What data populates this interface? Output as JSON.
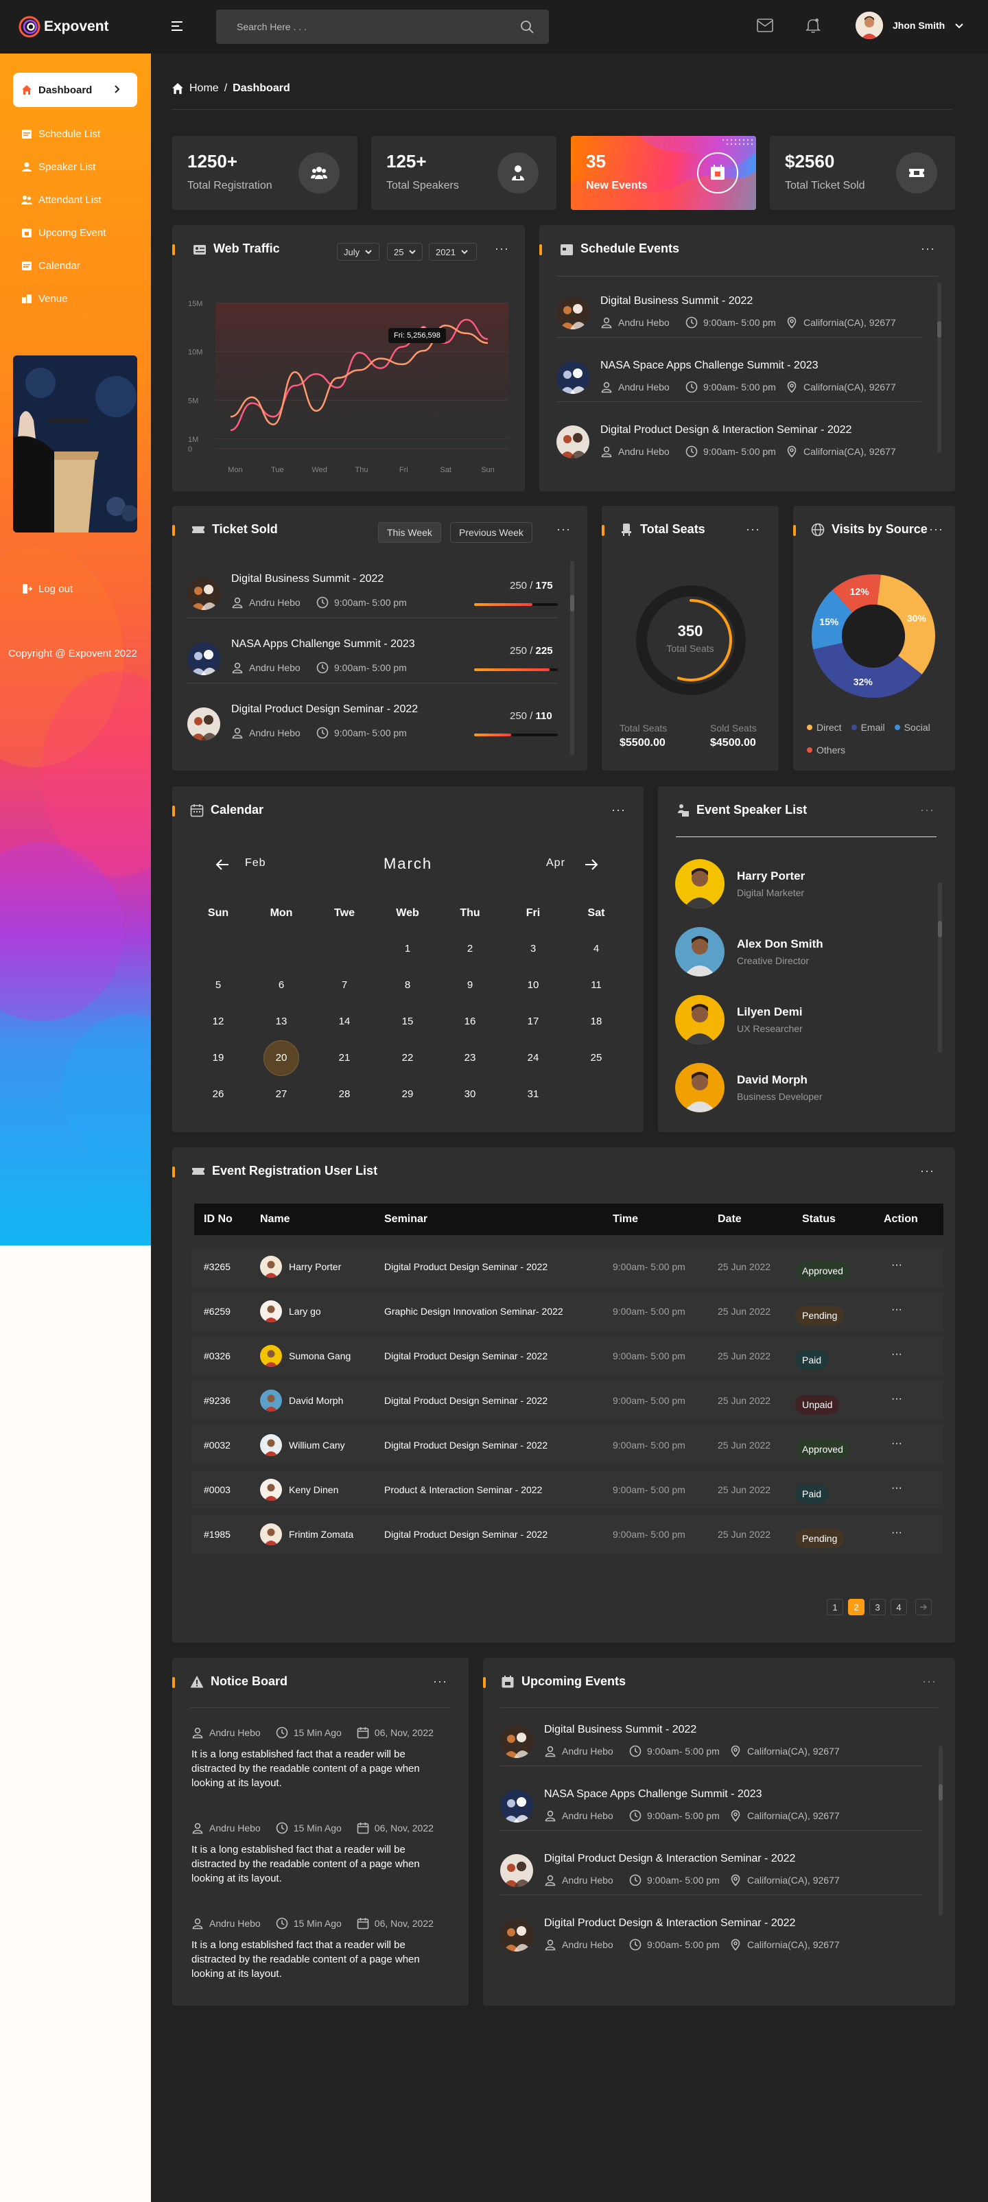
{
  "app": {
    "name": "Expovent"
  },
  "sidebar": {
    "items": [
      {
        "label": "Dashboard"
      },
      {
        "label": "Schedule List"
      },
      {
        "label": "Speaker List"
      },
      {
        "label": "Attendant List"
      },
      {
        "label": "Upcomg Event"
      },
      {
        "label": "Calendar"
      },
      {
        "label": "Venue"
      }
    ],
    "logout": "Log out",
    "copyright": "Copyright @ Expovent 2022"
  },
  "header": {
    "search_placeholder": "Search Here . . .",
    "user_name": "Jhon Smith"
  },
  "breadcrumb": {
    "home": "Home",
    "separator": "/",
    "current": "Dashboard"
  },
  "stats": [
    {
      "value": "1250+",
      "label": "Total Registration"
    },
    {
      "value": "125+",
      "label": "Total Speakers"
    },
    {
      "value": "35",
      "label": "New Events"
    },
    {
      "value": "$2560",
      "label": "Total Ticket Sold"
    }
  ],
  "web_traffic": {
    "title": "Web Traffic",
    "filters": [
      "July",
      "25",
      "2021"
    ],
    "tooltip": "Fri: 5,256,598",
    "chart_data": {
      "type": "line",
      "categories": [
        "Mon",
        "Tue",
        "Wed",
        "Thu",
        "Fri",
        "Sat",
        "Sun"
      ],
      "y_ticks": [
        "15M",
        "10M",
        "5M",
        "1M",
        "0"
      ],
      "ylim": [
        0,
        15
      ],
      "series": [
        {
          "color": "#ff5b7e",
          "values": [
            1.2,
            4.0,
            2.6,
            5.8,
            7.0,
            5.6,
            9.2,
            7.6,
            9.8,
            11.6,
            10.2,
            12.6,
            10.6
          ]
        },
        {
          "color": "#ff9a6e",
          "values": [
            2.6,
            4.6,
            1.8,
            7.2,
            3.2,
            6.6,
            7.4,
            8.6,
            8.0,
            9.4,
            12.0,
            11.2,
            10.2
          ]
        }
      ]
    }
  },
  "schedule": {
    "title": "Schedule Events",
    "events": [
      {
        "title": "Digital Business Summit - 2022",
        "speaker": "Andru Hebo",
        "time": "9:00am- 5:00 pm",
        "location": "California(CA), 92677"
      },
      {
        "title": "NASA Space Apps Challenge Summit - 2023",
        "speaker": "Andru Hebo",
        "time": "9:00am- 5:00 pm",
        "location": "California(CA), 92677"
      },
      {
        "title": "Digital Product Design & Interaction Seminar - 2022",
        "speaker": "Andru Hebo",
        "time": "9:00am- 5:00 pm",
        "location": "California(CA), 92677"
      }
    ]
  },
  "ticket_sold": {
    "title": "Ticket Sold",
    "tabs": [
      "This Week",
      "Previous Week"
    ],
    "rows": [
      {
        "title": "Digital Business Summit - 2022",
        "speaker": "Andru Hebo",
        "time": "9:00am- 5:00 pm",
        "total": "250 /",
        "sold": "175",
        "progress": 0.7
      },
      {
        "title": "NASA Apps Challenge Summit - 2023",
        "speaker": "Andru Hebo",
        "time": "9:00am- 5:00 pm",
        "total": "250 /",
        "sold": "225",
        "progress": 0.9
      },
      {
        "title": "Digital Product Design Seminar - 2022",
        "speaker": "Andru Hebo",
        "time": "9:00am- 5:00 pm",
        "total": "250 /",
        "sold": "110",
        "progress": 0.44
      }
    ]
  },
  "total_seats": {
    "title": "Total Seats",
    "value": "350",
    "label": "Total Seats",
    "progress": 0.55,
    "total_label": "Total Seats",
    "total_value": "$5500.00",
    "sold_label": "Sold Seats",
    "sold_value": "$4500.00"
  },
  "visits": {
    "title": "Visits by Source",
    "chart_data": {
      "type": "pie",
      "slices": [
        {
          "label": "30%",
          "value": 30,
          "color": "#f9b54a"
        },
        {
          "label": "32%",
          "value": 32,
          "color": "#3b4a9a"
        },
        {
          "label": "15%",
          "value": 15,
          "color": "#3a8fd9"
        },
        {
          "label": "12%",
          "value": 12,
          "color": "#e9543e"
        }
      ],
      "legend": [
        {
          "label": "Direct",
          "color": "#f9b54a"
        },
        {
          "label": "Email",
          "color": "#3b4a9a"
        },
        {
          "label": "Social",
          "color": "#3a8fd9"
        },
        {
          "label": "Others",
          "color": "#e9543e"
        }
      ]
    }
  },
  "calendar": {
    "title": "Calendar",
    "prev": "Feb",
    "month": "March",
    "next": "Apr",
    "days": [
      "Sun",
      "Mon",
      "Twe",
      "Web",
      "Thu",
      "Fri",
      "Sat"
    ],
    "weeks": [
      [
        "",
        "",
        "",
        "1",
        "2",
        "3",
        "4"
      ],
      [
        "5",
        "6",
        "7",
        "8",
        "9",
        "10",
        "11"
      ],
      [
        "12",
        "13",
        "14",
        "15",
        "16",
        "17",
        "18"
      ],
      [
        "19",
        "20",
        "21",
        "22",
        "23",
        "24",
        "25"
      ],
      [
        "26",
        "27",
        "28",
        "29",
        "30",
        "31",
        ""
      ]
    ],
    "today": "20"
  },
  "speakers": {
    "title": "Event Speaker List",
    "items": [
      {
        "name": "Harry Porter",
        "role": "Digital Marketer"
      },
      {
        "name": "Alex Don Smith",
        "role": "Creative Director"
      },
      {
        "name": "Lilyen Demi",
        "role": "UX Researcher"
      },
      {
        "name": "David Morph",
        "role": "Business Developer"
      }
    ]
  },
  "registration": {
    "title": "Event Registration User List",
    "columns": [
      "ID No",
      "Name",
      "Seminar",
      "Time",
      "Date",
      "Status",
      "Action"
    ],
    "rows": [
      {
        "id": "#3265",
        "name": "Harry Porter",
        "seminar": "Digital Product Design Seminar - 2022",
        "time": "9:00am- 5:00 pm",
        "date": "25 Jun  2022",
        "status": "Approved",
        "action": "···"
      },
      {
        "id": "#6259",
        "name": "Lary go",
        "seminar": "Graphic Design Innovation Seminar- 2022",
        "time": "9:00am- 5:00 pm",
        "date": "25 Jun  2022",
        "status": "Pending",
        "action": "···"
      },
      {
        "id": "#0326",
        "name": "Sumona Gang",
        "seminar": "Digital Product Design Seminar - 2022",
        "time": "9:00am- 5:00 pm",
        "date": "25 Jun  2022",
        "status": "Paid",
        "action": "···"
      },
      {
        "id": "#9236",
        "name": "David Morph",
        "seminar": "Digital Product Design Seminar - 2022",
        "time": "9:00am- 5:00 pm",
        "date": "25 Jun  2022",
        "status": "Unpaid",
        "action": "···"
      },
      {
        "id": "#0032",
        "name": "Willium Cany",
        "seminar": "Digital Product Design Seminar - 2022",
        "time": "9:00am- 5:00 pm",
        "date": "25 Jun  2022",
        "status": "Approved",
        "action": "···"
      },
      {
        "id": "#0003",
        "name": "Keny Dinen",
        "seminar": "Product & Interaction Seminar - 2022",
        "time": "9:00am- 5:00 pm",
        "date": "25 Jun  2022",
        "status": "Paid",
        "action": "···"
      },
      {
        "id": "#1985",
        "name": "Frintim Zomata",
        "seminar": "Digital Product Design Seminar - 2022",
        "time": "9:00am- 5:00 pm",
        "date": "25 Jun  2022",
        "status": "Pending",
        "action": "···"
      }
    ],
    "pages": [
      "1",
      "2",
      "3",
      "4"
    ],
    "current_page": "2"
  },
  "notice": {
    "title": "Notice Board",
    "items": [
      {
        "author": "Andru Hebo",
        "ago": "15 Min Ago",
        "date": "06, Nov, 2022",
        "text": "It is a long established fact that a reader will be distracted by the readable content of a page when looking at its layout."
      },
      {
        "author": "Andru Hebo",
        "ago": "15 Min Ago",
        "date": "06, Nov, 2022",
        "text": "It is a long established fact that a reader will be distracted by the readable content of a page when looking at its layout."
      },
      {
        "author": "Andru Hebo",
        "ago": "15 Min Ago",
        "date": "06, Nov, 2022",
        "text": "It is a long established fact that a reader will be distracted by the readable content of a page when looking at its layout."
      }
    ]
  },
  "upcoming": {
    "title": "Upcoming Events",
    "events": [
      {
        "title": "Digital Business Summit - 2022",
        "speaker": "Andru Hebo",
        "time": "9:00am- 5:00 pm",
        "location": "California(CA), 92677"
      },
      {
        "title": "NASA Space Apps Challenge Summit - 2023",
        "speaker": "Andru Hebo",
        "time": "9:00am- 5:00 pm",
        "location": "California(CA), 92677"
      },
      {
        "title": "Digital Product Design & Interaction Seminar - 2022",
        "speaker": "Andru Hebo",
        "time": "9:00am- 5:00 pm",
        "location": "California(CA), 92677"
      },
      {
        "title": "Digital Product Design & Interaction Seminar - 2022",
        "speaker": "Andru Hebo",
        "time": "9:00am- 5:00 pm",
        "location": "California(CA), 92677"
      }
    ]
  },
  "colors": {
    "accent": "#ff9e12",
    "panel": "#2f2f2f",
    "background": "#222222"
  }
}
